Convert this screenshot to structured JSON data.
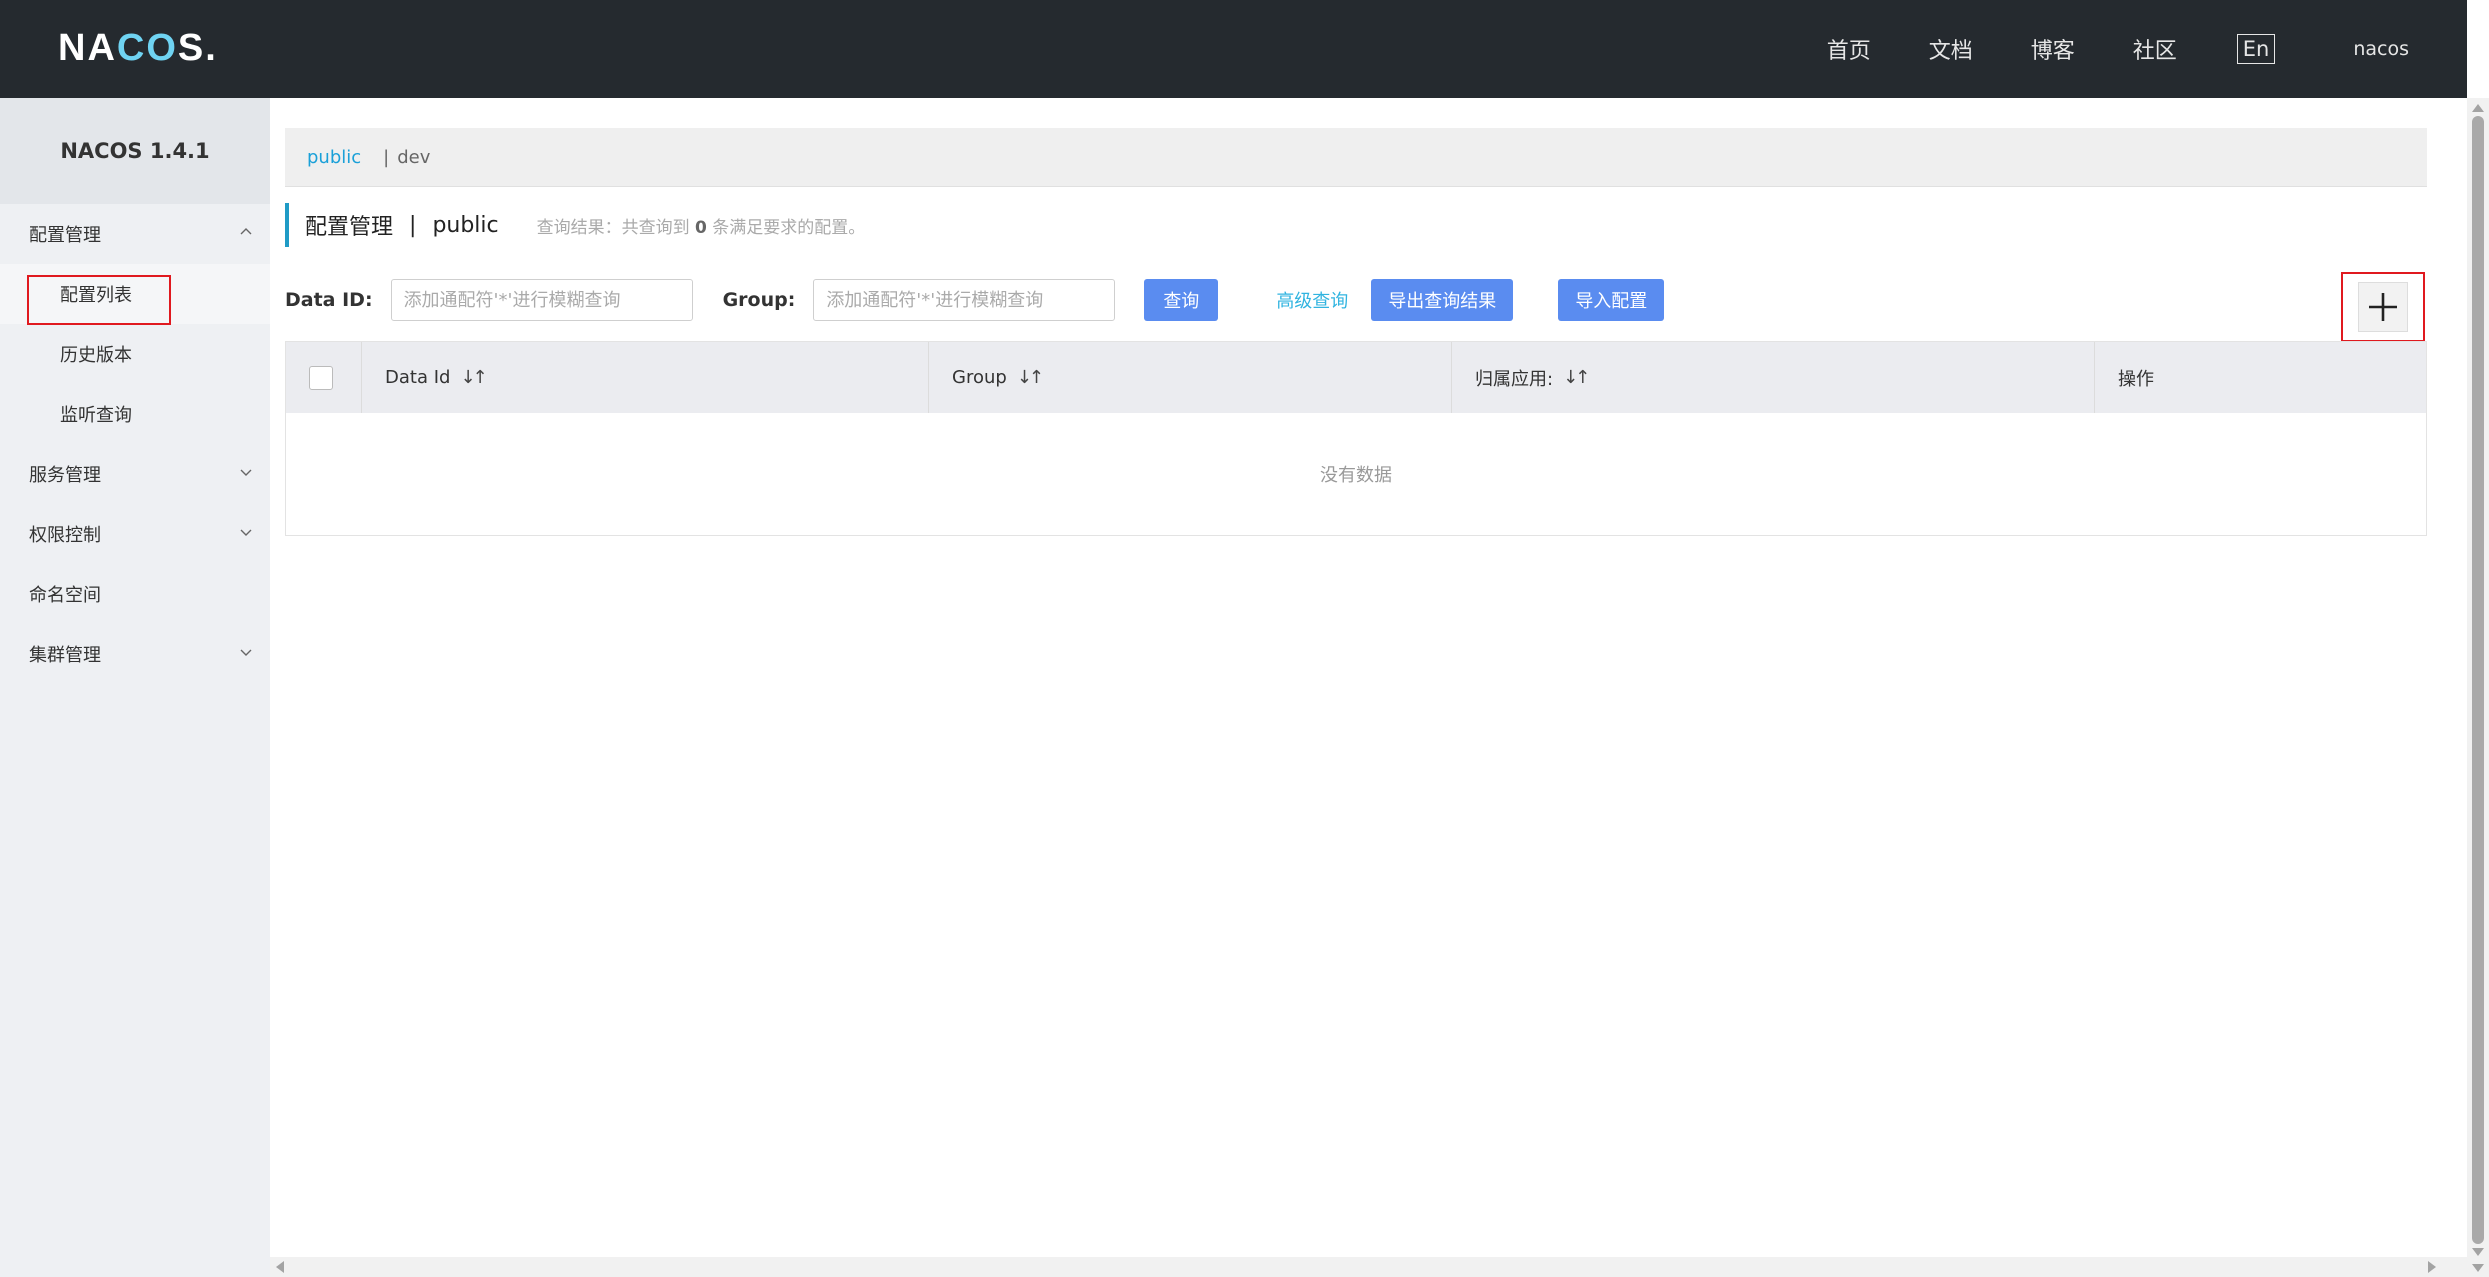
{
  "header": {
    "logo": {
      "prefix": "NA",
      "accent": "CO",
      "suffix": "S."
    },
    "nav": [
      "首页",
      "文档",
      "博客",
      "社区"
    ],
    "lang": "En",
    "user": "nacos"
  },
  "sidebar": {
    "version": "NACOS 1.4.1",
    "groups": [
      {
        "label": "配置管理",
        "expanded": true,
        "items": [
          "配置列表",
          "历史版本",
          "监听查询"
        ]
      },
      {
        "label": "服务管理",
        "expanded": false
      },
      {
        "label": "权限控制",
        "expanded": false
      },
      {
        "label": "命名空间"
      },
      {
        "label": "集群管理",
        "expanded": false
      }
    ],
    "active_item": "配置列表"
  },
  "namespaces": {
    "active": "public",
    "sep": "|",
    "other": "dev"
  },
  "page": {
    "title": "配置管理",
    "title_sep": "|",
    "namespace": "public",
    "result_prefix": "查询结果：共查询到",
    "result_count": "0",
    "result_suffix": "条满足要求的配置。"
  },
  "filters": {
    "dataid_label": "Data ID:",
    "dataid_placeholder": "添加通配符'*'进行模糊查询",
    "group_label": "Group:",
    "group_placeholder": "添加通配符'*'进行模糊查询",
    "query_button": "查询",
    "advanced_query": "高级查询",
    "export_button": "导出查询结果",
    "import_button": "导入配置"
  },
  "table": {
    "columns": [
      "Data Id",
      "Group",
      "归属应用:",
      "操作"
    ],
    "empty_text": "没有数据"
  },
  "colors": {
    "header_bg": "#252a2f",
    "primary": "#5a8cf0",
    "link": "#1aa0d8",
    "highlight": "#e0191f"
  }
}
